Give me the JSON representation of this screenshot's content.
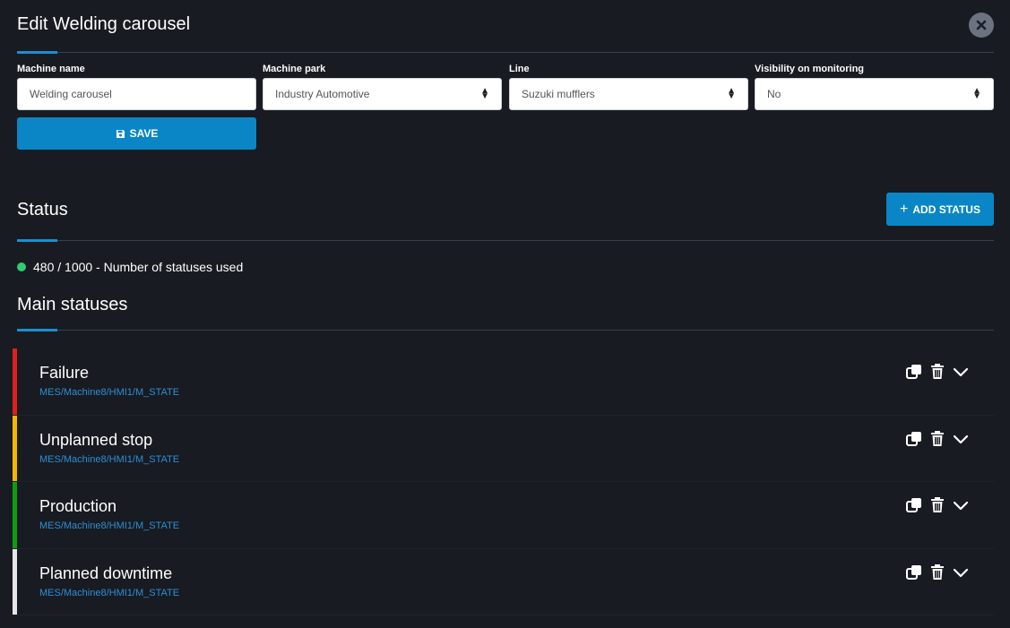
{
  "header": {
    "title": "Edit Welding carousel",
    "close_icon": "close-icon"
  },
  "form": {
    "machine_name": {
      "label": "Machine name",
      "value": "Welding carousel"
    },
    "machine_park": {
      "label": "Machine park",
      "value": "Industry Automotive"
    },
    "line": {
      "label": "Line",
      "value": "Suzuki mufflers"
    },
    "visibility": {
      "label": "Visibility on monitoring",
      "value": "No"
    },
    "save_label": "SAVE"
  },
  "status_section": {
    "title": "Status",
    "add_label": "ADD STATUS",
    "usage_text": "480 / 1000 - Number of statuses used",
    "usage_color": "#2ecc71"
  },
  "main_statuses": {
    "title": "Main statuses",
    "items": [
      {
        "name": "Failure",
        "topic": "MES/Machine8/HMI1/M_STATE",
        "color": "#e01e1e"
      },
      {
        "name": "Unplanned stop",
        "topic": "MES/Machine8/HMI1/M_STATE",
        "color": "#f2b705"
      },
      {
        "name": "Production",
        "topic": "MES/Machine8/HMI1/M_STATE",
        "color": "#119b11"
      },
      {
        "name": "Planned downtime",
        "topic": "MES/Machine8/HMI1/M_STATE",
        "color": "#e6e6e6"
      }
    ]
  },
  "colors": {
    "accent": "#0a86c6",
    "background": "#181b21",
    "topic_link": "#2d8fd8"
  }
}
